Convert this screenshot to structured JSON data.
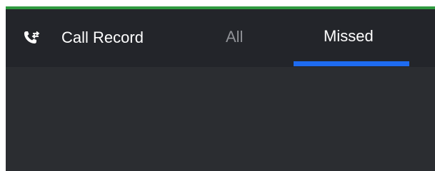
{
  "header": {
    "title": "Call Record",
    "icon": "call-transfer-icon"
  },
  "tabs": [
    {
      "label": "All",
      "selected": false
    },
    {
      "label": "Missed",
      "selected": true
    }
  ],
  "colors": {
    "accent_bar": "#2f9a3f",
    "header_background": "#23252a",
    "panel_background": "#2b2d31",
    "active_tab_indicator": "#1e6bf0",
    "inactive_tab_text": "#8f9196",
    "active_tab_text": "#ffffff"
  }
}
